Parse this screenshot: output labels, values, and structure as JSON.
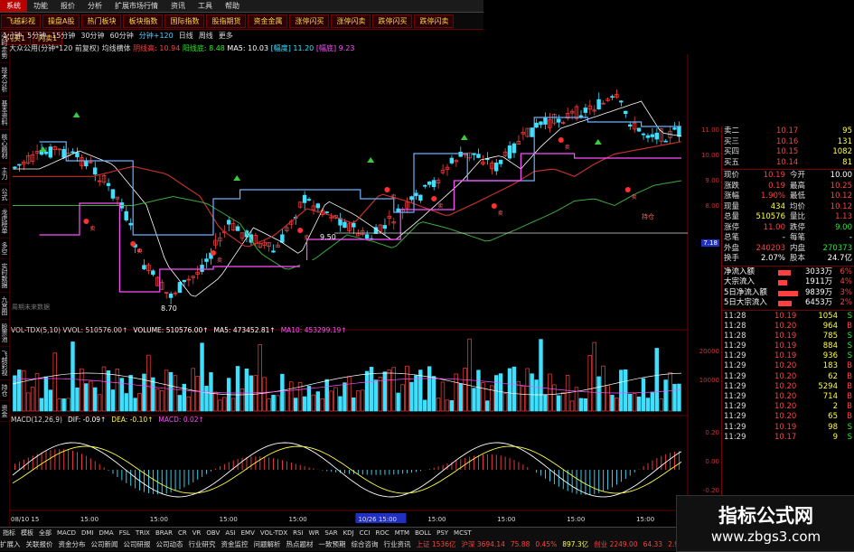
{
  "menu": {
    "items": [
      "系统",
      "功能",
      "报价",
      "分析",
      "扩展市场行情",
      "资讯",
      "工具",
      "帮助"
    ],
    "active": "系统"
  },
  "toolbar": {
    "buttons": [
      "飞越彩视",
      "操盘A股",
      "热门板块",
      "板块指数",
      "国际指数",
      "股指期货",
      "资金金属",
      "涨停闪买",
      "涨停闪卖",
      "跌停闪买",
      "跌停闪卖",
      "闪买1",
      "闪卖1"
    ]
  },
  "period": {
    "items": [
      "1分钟",
      "5分钟",
      "15分钟",
      "30分钟",
      "60分钟",
      "分钟+120",
      "日线",
      "周线",
      "更多"
    ],
    "active": "分钟+120"
  },
  "info": {
    "title": "大众公用(分钟*120 前复权) 均线横体",
    "items": [
      {
        "text": "阴线高: 10.94",
        "color": "#ff4040"
      },
      {
        "text": "阳线底: 8.48",
        "color": "#2ee82e"
      },
      {
        "text": "MA5: 10.03",
        "color": "#ffffff"
      },
      {
        "text": "[幅度] 11.20",
        "color": "#3ee0ff"
      },
      {
        "text": "[幅底] 9.23",
        "color": "#ff50ff"
      }
    ]
  },
  "price_labels": {
    "low": "8.70",
    "mid": "9.50",
    "current": "7.18"
  },
  "ann": {
    "buy": "卖",
    "hold": "持仓"
  },
  "vol_header": [
    {
      "text": "VOL-TDX(5,10) VVOL: 510576.00↑",
      "color": "#dddddd"
    },
    {
      "text": "VOLUME: 510576.00↑",
      "color": "#ffffff"
    },
    {
      "text": "MA5: 473452.81↑",
      "color": "#ffffff"
    },
    {
      "text": "MA10: 453299.19↑",
      "color": "#ff50ff"
    }
  ],
  "macd_header": [
    {
      "text": "MACD(12,26,9)",
      "color": "#dddddd"
    },
    {
      "text": "DIF: -0.09↑",
      "color": "#ffffff"
    },
    {
      "text": "DEA: -0.10↑",
      "color": "#ffff40"
    },
    {
      "text": "MACD: 0.02↑",
      "color": "#ff50ff"
    }
  ],
  "axis": {
    "price_ticks": [
      "11.00",
      "10.00",
      "9.00",
      "8.00",
      "7.18"
    ],
    "vol_ticks": [
      "20000",
      "10000"
    ],
    "macd_ticks": [
      "0.20",
      "0.00",
      "-0.20"
    ],
    "x_ticks": [
      "08/10 15",
      "15:00",
      "15:00",
      "15:00",
      "15:00",
      "10/26 15:00",
      "15:00",
      "15:00",
      "15:00",
      "15:00"
    ]
  },
  "watermark_line": "周期未来数据",
  "left_tabs": [
    "分时走势",
    "技术分析",
    "基本资料",
    "核心题材",
    "主力",
    "公式",
    "龙虎榜单",
    "多空",
    "实时数据",
    "九宫图",
    "股票池",
    "飞越彩视",
    "持仓",
    "资金"
  ],
  "quote": {
    "asks": [
      {
        "label": "卖二",
        "price": "10.17",
        "vol": "95"
      },
      {
        "label": "买三",
        "price": "10.16",
        "vol": "131"
      },
      {
        "label": "买四",
        "price": "10.15",
        "vol": "1082"
      },
      {
        "label": "买五",
        "price": "10.14",
        "vol": "81"
      }
    ],
    "stats": [
      {
        "l1": "现价",
        "v1": "10.19",
        "l2": "今开",
        "v2": "10.00",
        "c1": "#ff4040",
        "c2": "#ffffff"
      },
      {
        "l1": "涨跌",
        "v1": "0.19",
        "l2": "最高",
        "v2": "10.25",
        "c1": "#ff4040",
        "c2": "#ff4040"
      },
      {
        "l1": "涨幅",
        "v1": "1.90%",
        "l2": "最低",
        "v2": "10.12",
        "c1": "#ff4040",
        "c2": "#ff4040"
      },
      {
        "l1": "现量",
        "v1": "434",
        "l2": "均价",
        "v2": "10.12",
        "c1": "#ffff40",
        "c2": "#ff4040"
      },
      {
        "l1": "总量",
        "v1": "510576",
        "l2": "量比",
        "v2": "1.13",
        "c1": "#ffff40",
        "c2": "#ff4040"
      },
      {
        "l1": "涨停",
        "v1": "11.00",
        "l2": "跌停",
        "v2": "9.00",
        "c1": "#ff4040",
        "c2": "#2ee82e"
      },
      {
        "l1": "总笔",
        "v1": "-",
        "l2": "每笔",
        "v2": "-",
        "c1": "#ffffff",
        "c2": "#ffffff"
      },
      {
        "l1": "外盘",
        "v1": "240203",
        "l2": "内盘",
        "v2": "270373",
        "c1": "#ff4040",
        "c2": "#2ee82e"
      },
      {
        "l1": "换手",
        "v1": "2.07%",
        "l2": "股本",
        "v2": "24.7亿",
        "c1": "#ffffff",
        "c2": "#ffffff"
      }
    ],
    "flows": [
      {
        "label": "净流入额",
        "value": "3033万",
        "pct": "6%",
        "fill": 0.5
      },
      {
        "label": "大宗流入",
        "value": "1911万",
        "pct": "4%",
        "fill": 0.35
      },
      {
        "label": "5日净流入额",
        "value": "9839万",
        "pct": "3%",
        "fill": 0.8
      },
      {
        "label": "5日大宗流入",
        "value": "6453万",
        "pct": "2%",
        "fill": 0.55
      }
    ],
    "ticks": [
      {
        "t": "11:28",
        "p": "10.19",
        "v": "1054",
        "d": "S"
      },
      {
        "t": "11:28",
        "p": "10.20",
        "v": "964",
        "d": "B"
      },
      {
        "t": "11:28",
        "p": "10.19",
        "v": "785",
        "d": "S"
      },
      {
        "t": "11:29",
        "p": "10.19",
        "v": "884",
        "d": "S"
      },
      {
        "t": "11:29",
        "p": "10.19",
        "v": "936",
        "d": "S"
      },
      {
        "t": "11:29",
        "p": "10.20",
        "v": "183",
        "d": "B"
      },
      {
        "t": "11:29",
        "p": "10.20",
        "v": "62",
        "d": "B"
      },
      {
        "t": "11:29",
        "p": "10.20",
        "v": "5294",
        "d": "B"
      },
      {
        "t": "11:29",
        "p": "10.20",
        "v": "714",
        "d": "B"
      },
      {
        "t": "11:29",
        "p": "10.20",
        "v": "2",
        "d": "B"
      },
      {
        "t": "11:29",
        "p": "10.20",
        "v": "65",
        "d": "B"
      },
      {
        "t": "11:29",
        "p": "10.19",
        "v": "98",
        "d": "S"
      },
      {
        "t": "11:29",
        "p": "10.17",
        "v": "9",
        "d": "S"
      }
    ]
  },
  "footer": {
    "indicators": [
      "指标",
      "模板",
      "全部",
      "MACD",
      "DMI",
      "DMA",
      "FSL",
      "TRIX",
      "BRAR",
      "CR",
      "VR",
      "OBV",
      "ASI",
      "EMV",
      "VOL-TDX",
      "RSI",
      "WR",
      "SAR",
      "KDJ",
      "CCI",
      "ROC",
      "MTM",
      "BOLL",
      "PSY",
      "MCST"
    ],
    "status": [
      {
        "text": "扩展入",
        "color": "#dddddd"
      },
      {
        "text": "关联报价",
        "color": "#dddddd"
      },
      {
        "text": "资金分布",
        "color": "#dddddd"
      },
      {
        "text": "公司新闻",
        "color": "#dddddd"
      },
      {
        "text": "公司研报",
        "color": "#dddddd"
      },
      {
        "text": "公司动态",
        "color": "#dddddd"
      },
      {
        "text": "行业研究",
        "color": "#dddddd"
      },
      {
        "text": "资金监控",
        "color": "#dddddd"
      },
      {
        "text": "问题解析",
        "color": "#dddddd"
      },
      {
        "text": "热点题材",
        "color": "#dddddd"
      },
      {
        "text": "一致预期",
        "color": "#dddddd"
      },
      {
        "text": "综合咨询",
        "color": "#dddddd"
      },
      {
        "text": "行业资讯",
        "color": "#dddddd"
      }
    ],
    "market": [
      {
        "text": "上证 1536亿",
        "color": "#ff4040"
      },
      {
        "text": "沪深 3694.14",
        "color": "#ff4040"
      },
      {
        "text": "75.88",
        "color": "#ff4040"
      },
      {
        "text": "0.45%",
        "color": "#ff4040"
      },
      {
        "text": "897.3亿",
        "color": "#ffff40"
      },
      {
        "text": "创业 2249.00",
        "color": "#ff4040"
      },
      {
        "text": "64.33",
        "color": "#ff4040"
      },
      {
        "text": "2.9%",
        "color": "#ff4040"
      },
      {
        "text": "799.8亿",
        "color": "#ffff40"
      },
      {
        "text": "杭州电信 0",
        "color": "#dddddd"
      },
      {
        "text": "杭州华数主站 2",
        "color": "#dddddd"
      }
    ],
    "date_badge": "10/26 15:00"
  },
  "watermark": {
    "brand": "指标公式网",
    "url": "www.zbgs3.com"
  },
  "colors": {
    "up": "#ff4040",
    "down": "#3ee0ff",
    "ma_red": "#c0302a",
    "ma_green": "#3caa3c",
    "blue_line": "#6ab0ff",
    "mag_line": "#ff50ff"
  }
}
